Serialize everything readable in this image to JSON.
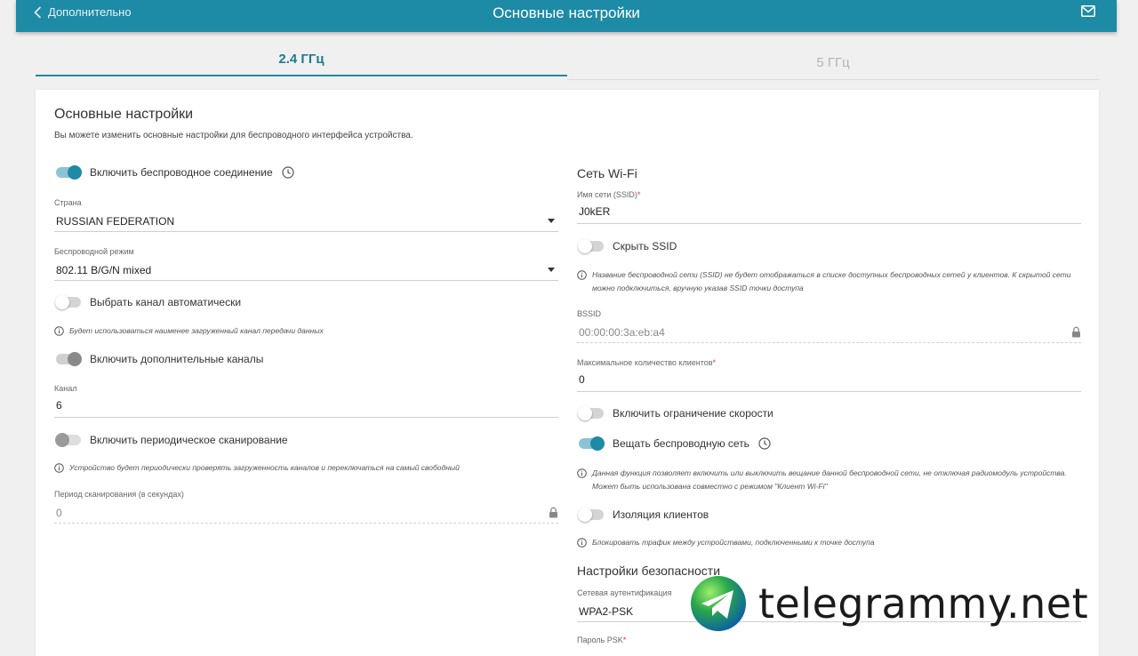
{
  "header": {
    "back_label": "Дополнительно",
    "title": "Основные настройки"
  },
  "tabs": [
    {
      "label": "2.4 ГГц",
      "active": true
    },
    {
      "label": "5 ГГц",
      "active": false
    }
  ],
  "card": {
    "title": "Основные настройки",
    "description": "Вы можете изменить основные настройки для беспроводного интерфейса устройства."
  },
  "left": {
    "enable_wireless": {
      "label": "Включить беспроводное соединение",
      "state": "on"
    },
    "country": {
      "label": "Страна",
      "value": "RUSSIAN FEDERATION"
    },
    "wireless_mode": {
      "label": "Беспроводной режим",
      "value": "802.11 B/G/N mixed"
    },
    "auto_channel": {
      "label": "Выбрать канал автоматически",
      "state": "off",
      "hint": "Будет использоваться наименее загруженный канал передачи данных"
    },
    "extra_channels": {
      "label": "Включить дополнительные каналы",
      "state": "disabled-on"
    },
    "channel": {
      "label": "Канал",
      "value": "6"
    },
    "periodic_scan": {
      "label": "Включить периодическое сканирование",
      "state": "disabled-off",
      "hint": "Устройство будет периодически проверять загруженность каналов и переключаться на самый свободный"
    },
    "scan_period": {
      "label": "Период сканирования (в секундах)",
      "value": "0"
    }
  },
  "right": {
    "wifi_heading": "Сеть Wi-Fi",
    "ssid": {
      "label": "Имя сети (SSID)",
      "required_mark": "*",
      "value": "J0kER"
    },
    "hide_ssid": {
      "label": "Скрыть SSID",
      "state": "off",
      "hint_line1": "Название беспроводной сети (SSID) не будет отображаться в списке доступных беспроводных сетей у клиентов. К скрытой сети",
      "hint_line2": "можно подключиться, вручную указав SSID точки доступа"
    },
    "bssid": {
      "label": "BSSID",
      "value": "00:00:00:3a:eb:a4"
    },
    "max_clients": {
      "label": "Максимальное количество клиентов",
      "required_mark": "*",
      "value": "0"
    },
    "speed_limit": {
      "label": "Включить ограничение скорости",
      "state": "off"
    },
    "broadcast": {
      "label": "Вещать беспроводную сеть",
      "state": "on",
      "hint_line1": "Данная функция позволяет включить или выключить вещание данной беспроводной сети, не отключая радиомодуль устройства.",
      "hint_line2": "Может быть использована совместно с режимом \"Клиент Wi-Fi\""
    },
    "isolation": {
      "label": "Изоляция клиентов",
      "state": "off",
      "hint": "Блокировать трафик между устройствами, подключенными к точке доступа"
    },
    "security_heading": "Настройки безопасности",
    "auth": {
      "label": "Сетевая аутентификация",
      "value": "WPA2-PSK"
    },
    "psk": {
      "label": "Пароль PSK",
      "required_mark": "*"
    }
  },
  "watermark": {
    "text": "telegrammy.net"
  },
  "colors": {
    "accent": "#1d8aa6",
    "background": "#f0f0f0"
  }
}
